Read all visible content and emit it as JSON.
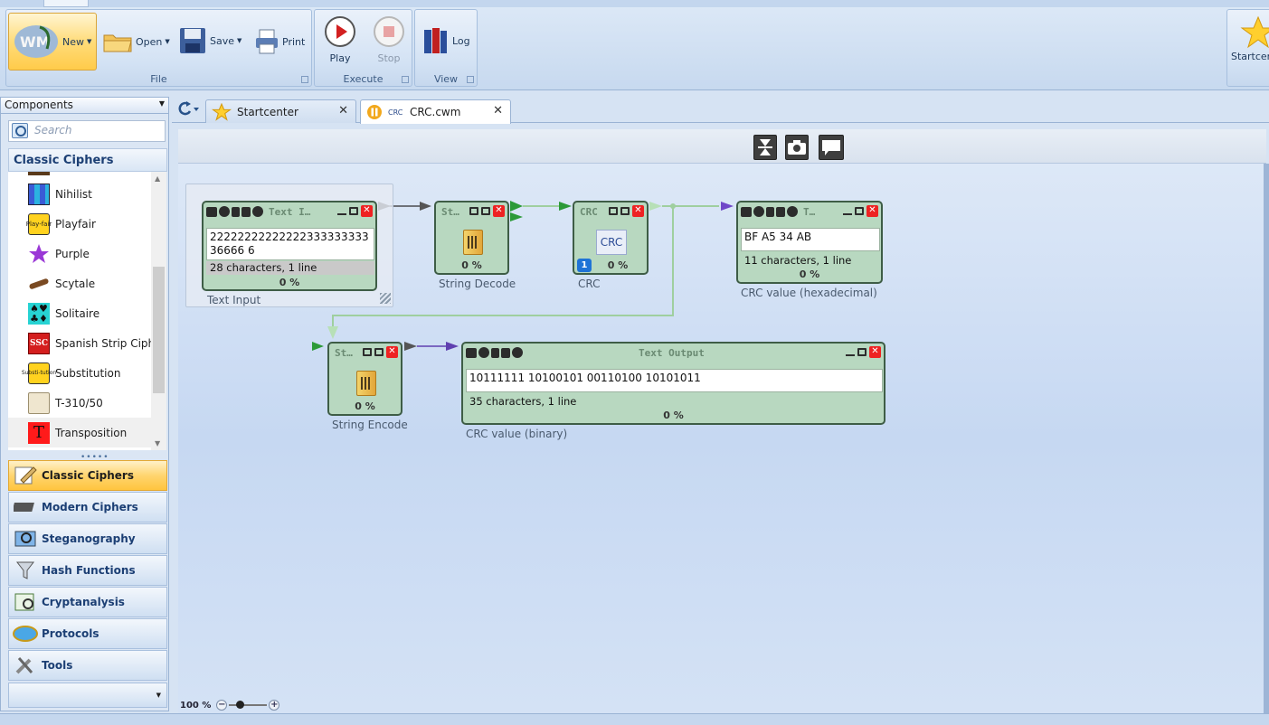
{
  "ribbon": {
    "groups": [
      {
        "caption": "File"
      },
      {
        "caption": "Execute"
      },
      {
        "caption": "View"
      }
    ],
    "file": {
      "new": "New",
      "open": "Open",
      "save": "Save",
      "print": "Print"
    },
    "execute": {
      "play": "Play",
      "stop": "Stop"
    },
    "view": {
      "log": "Log"
    },
    "startcenter": "Startcen"
  },
  "left_panel": {
    "header": "Components",
    "search_placeholder": "Search",
    "category_title": "Classic Ciphers",
    "items": [
      {
        "label": "Nihilist",
        "icon": "nihilist-icon"
      },
      {
        "label": "Playfair",
        "icon": "playfair-icon"
      },
      {
        "label": "Purple",
        "icon": "purple-star-icon"
      },
      {
        "label": "Scytale",
        "icon": "scytale-icon"
      },
      {
        "label": "Solitaire",
        "icon": "card-suits-icon"
      },
      {
        "label": "Spanish Strip Ciphe",
        "icon": "ssc-icon"
      },
      {
        "label": "Substitution",
        "icon": "substitution-icon"
      },
      {
        "label": "T-310/50",
        "icon": "t310-icon"
      },
      {
        "label": "Transposition",
        "icon": "transposition-icon"
      }
    ],
    "playfair_icon_text": "Play-fair",
    "ssc_icon_text": "SSC",
    "substitution_icon_text": "Substi-tution",
    "transposition_icon_text": "T",
    "categories": [
      {
        "label": "Classic Ciphers",
        "active": true
      },
      {
        "label": "Modern Ciphers"
      },
      {
        "label": "Steganography"
      },
      {
        "label": "Hash Functions"
      },
      {
        "label": "Cryptanalysis"
      },
      {
        "label": "Protocols"
      },
      {
        "label": "Tools"
      }
    ]
  },
  "tabs": [
    {
      "label": "Startcenter"
    },
    {
      "label": "CRC.cwm",
      "badge": "CRC"
    }
  ],
  "workflow": {
    "text_input": {
      "title": "Text  I…",
      "value": "2222222222222233333333336666 6",
      "info": "28 characters,  1 line",
      "progress": "0 %",
      "label": "Text Input"
    },
    "string_decode": {
      "title": "St…",
      "progress": "0 %",
      "label": "String Decode"
    },
    "crc": {
      "title": "CRC",
      "button": "CRC",
      "badge": "1",
      "progress": "0 %",
      "label": "CRC"
    },
    "crc_hex_output": {
      "title": "T…",
      "value": "BF A5 34 AB",
      "info": "11 characters,  1 line",
      "progress": "0 %",
      "label": "CRC value (hexadecimal)"
    },
    "string_encode": {
      "title": "St…",
      "progress": "0 %",
      "label": "String Encode"
    },
    "crc_bin_output": {
      "title": "Text Output",
      "value": "10111111 10100101 00110100 10101011",
      "info": "35 characters,  1 line",
      "progress": "0 %",
      "label": "CRC value (binary)"
    }
  },
  "zoom": "100 %",
  "colors": {
    "accent": "#ffc53e",
    "plugin_bg": "#b8d8c0",
    "plugin_border": "#3e5d46",
    "connector": "#9fcf9f"
  }
}
